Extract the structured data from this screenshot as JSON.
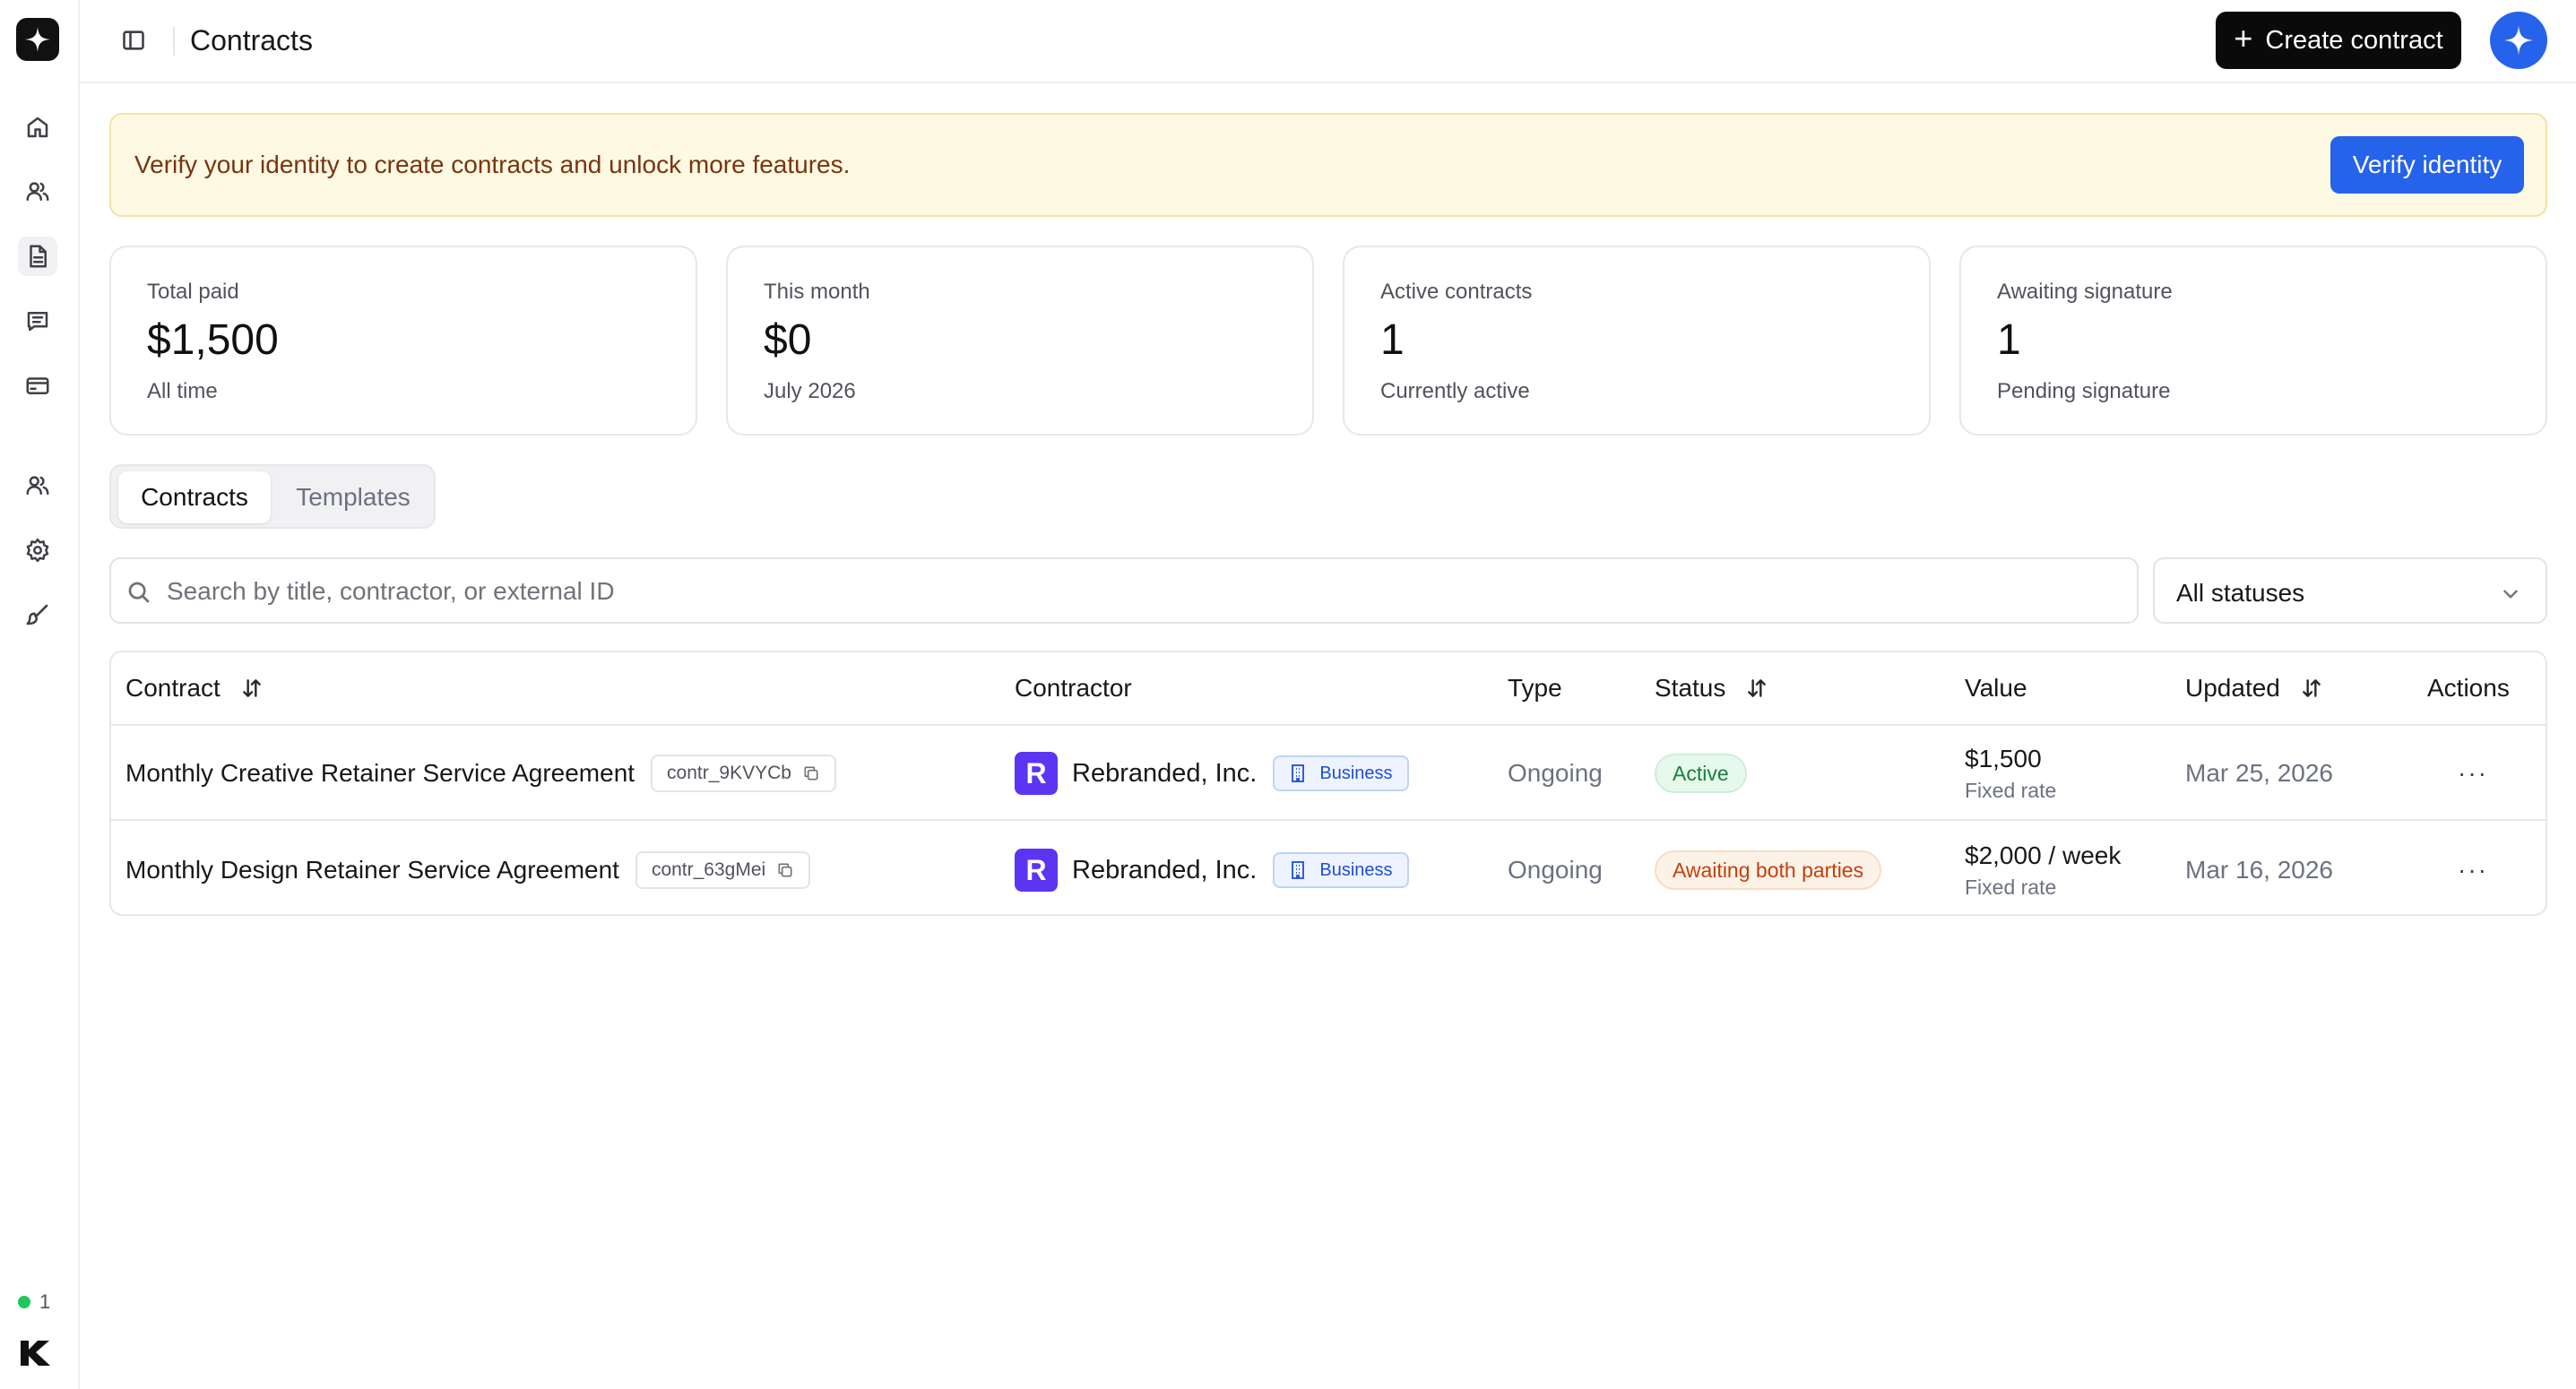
{
  "header": {
    "title": "Contracts",
    "create_label": "Create contract"
  },
  "banner": {
    "text": "Verify your identity to create contracts and unlock more features.",
    "button_label": "Verify identity"
  },
  "stats": [
    {
      "label": "Total paid",
      "value": "$1,500",
      "sub": "All time"
    },
    {
      "label": "This month",
      "value": "$0",
      "sub": "July 2026"
    },
    {
      "label": "Active contracts",
      "value": "1",
      "sub": "Currently active"
    },
    {
      "label": "Awaiting signature",
      "value": "1",
      "sub": "Pending signature"
    }
  ],
  "tabs": [
    {
      "label": "Contracts",
      "active": true
    },
    {
      "label": "Templates",
      "active": false
    }
  ],
  "search": {
    "placeholder": "Search by title, contractor, or external ID",
    "value": ""
  },
  "filter": {
    "selected": "All statuses"
  },
  "table": {
    "columns": [
      "Contract",
      "Contractor",
      "Type",
      "Status",
      "Value",
      "Updated",
      "Actions"
    ],
    "rows": [
      {
        "title": "Monthly Creative Retainer Service Agreement",
        "external_id": "contr_9KVYCb",
        "contractor_initial": "R",
        "contractor": "Rebranded, Inc.",
        "contractor_type": "Business",
        "type": "Ongoing",
        "status": "Active",
        "amount": "$1,500",
        "rate": "Fixed rate",
        "updated": "Mar 25, 2026",
        "actions": "···"
      },
      {
        "title": "Monthly Design Retainer Service Agreement",
        "external_id": "contr_63gMei",
        "contractor_initial": "R",
        "contractor": "Rebranded, Inc.",
        "contractor_type": "Business",
        "type": "Ongoing",
        "status": "Awaiting both parties",
        "amount": "$2,000 / week",
        "rate": "Fixed rate",
        "updated": "Mar 16, 2026",
        "actions": "···"
      }
    ]
  },
  "sidebar": {
    "online_count": "1",
    "icons": [
      "home-icon",
      "users-icon",
      "document-icon",
      "message-icon",
      "credit-card-icon",
      "team-icon",
      "settings-icon",
      "brush-icon"
    ]
  },
  "colors": {
    "primary_blue": "#2563eb",
    "banner_bg": "#fef9e3",
    "active_green": "#15803d",
    "awaiting_orange": "#c2410c",
    "contractor_brand": "#5b35f2"
  }
}
